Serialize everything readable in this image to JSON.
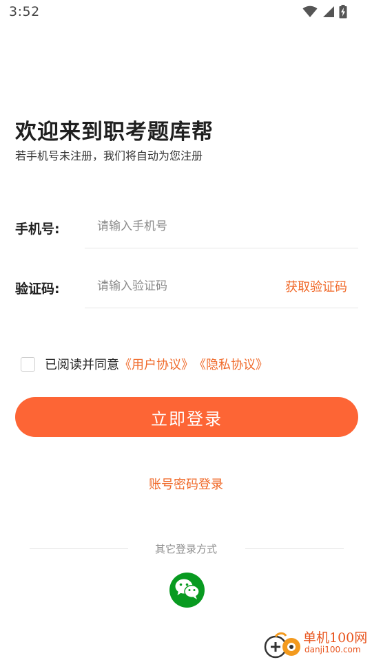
{
  "status_bar": {
    "time": "3:52",
    "icons": [
      "wifi-icon",
      "signal-icon",
      "battery-charging-icon"
    ]
  },
  "welcome": {
    "title": "欢迎来到职考题库帮",
    "subtitle": "若手机号未注册，我们将自动为您注册"
  },
  "form": {
    "phone": {
      "label": "手机号:",
      "value": "",
      "placeholder": "请输入手机号"
    },
    "code": {
      "label": "验证码:",
      "value": "",
      "placeholder": "请输入验证码",
      "get_code_label": "获取验证码"
    }
  },
  "agreement": {
    "checked": false,
    "text": "已阅读并同意",
    "user_agreement": "《用户协议》",
    "privacy_policy": "《隐私协议》"
  },
  "login_button_label": "立即登录",
  "account_login_label": "账号密码登录",
  "other_login": {
    "label": "其它登录方式",
    "methods": [
      "wechat-icon"
    ]
  },
  "watermark": {
    "brand": "单机100网",
    "url": "danji100.com"
  },
  "colors": {
    "accent": "#fd6535",
    "link": "#f06a2a",
    "wechat": "#089a20"
  }
}
